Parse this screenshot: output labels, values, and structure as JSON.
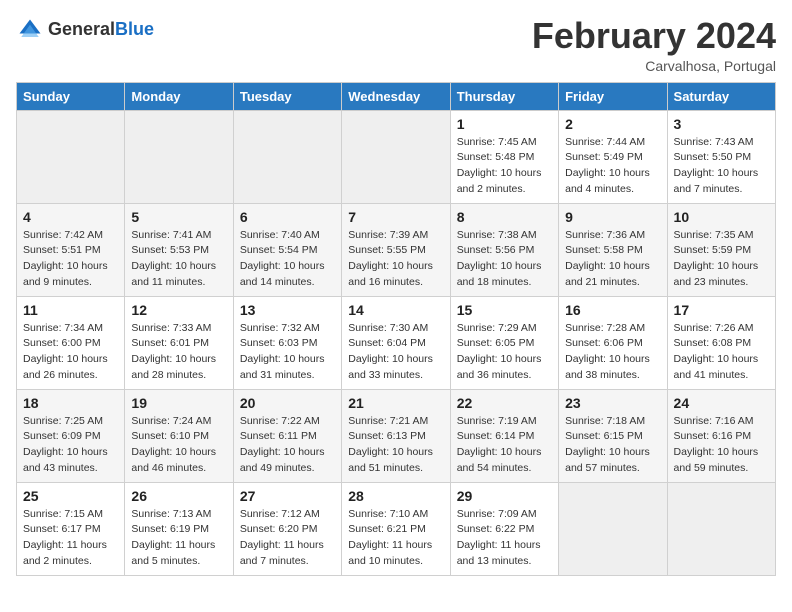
{
  "header": {
    "logo_general": "General",
    "logo_blue": "Blue",
    "month_year": "February 2024",
    "location": "Carvalhosa, Portugal"
  },
  "weekdays": [
    "Sunday",
    "Monday",
    "Tuesday",
    "Wednesday",
    "Thursday",
    "Friday",
    "Saturday"
  ],
  "weeks": [
    [
      {
        "day": "",
        "empty": true
      },
      {
        "day": "",
        "empty": true
      },
      {
        "day": "",
        "empty": true
      },
      {
        "day": "",
        "empty": true
      },
      {
        "day": "1",
        "sunrise": "7:45 AM",
        "sunset": "5:48 PM",
        "daylight": "10 hours and 2 minutes."
      },
      {
        "day": "2",
        "sunrise": "7:44 AM",
        "sunset": "5:49 PM",
        "daylight": "10 hours and 4 minutes."
      },
      {
        "day": "3",
        "sunrise": "7:43 AM",
        "sunset": "5:50 PM",
        "daylight": "10 hours and 7 minutes."
      }
    ],
    [
      {
        "day": "4",
        "sunrise": "7:42 AM",
        "sunset": "5:51 PM",
        "daylight": "10 hours and 9 minutes."
      },
      {
        "day": "5",
        "sunrise": "7:41 AM",
        "sunset": "5:53 PM",
        "daylight": "10 hours and 11 minutes."
      },
      {
        "day": "6",
        "sunrise": "7:40 AM",
        "sunset": "5:54 PM",
        "daylight": "10 hours and 14 minutes."
      },
      {
        "day": "7",
        "sunrise": "7:39 AM",
        "sunset": "5:55 PM",
        "daylight": "10 hours and 16 minutes."
      },
      {
        "day": "8",
        "sunrise": "7:38 AM",
        "sunset": "5:56 PM",
        "daylight": "10 hours and 18 minutes."
      },
      {
        "day": "9",
        "sunrise": "7:36 AM",
        "sunset": "5:58 PM",
        "daylight": "10 hours and 21 minutes."
      },
      {
        "day": "10",
        "sunrise": "7:35 AM",
        "sunset": "5:59 PM",
        "daylight": "10 hours and 23 minutes."
      }
    ],
    [
      {
        "day": "11",
        "sunrise": "7:34 AM",
        "sunset": "6:00 PM",
        "daylight": "10 hours and 26 minutes."
      },
      {
        "day": "12",
        "sunrise": "7:33 AM",
        "sunset": "6:01 PM",
        "daylight": "10 hours and 28 minutes."
      },
      {
        "day": "13",
        "sunrise": "7:32 AM",
        "sunset": "6:03 PM",
        "daylight": "10 hours and 31 minutes."
      },
      {
        "day": "14",
        "sunrise": "7:30 AM",
        "sunset": "6:04 PM",
        "daylight": "10 hours and 33 minutes."
      },
      {
        "day": "15",
        "sunrise": "7:29 AM",
        "sunset": "6:05 PM",
        "daylight": "10 hours and 36 minutes."
      },
      {
        "day": "16",
        "sunrise": "7:28 AM",
        "sunset": "6:06 PM",
        "daylight": "10 hours and 38 minutes."
      },
      {
        "day": "17",
        "sunrise": "7:26 AM",
        "sunset": "6:08 PM",
        "daylight": "10 hours and 41 minutes."
      }
    ],
    [
      {
        "day": "18",
        "sunrise": "7:25 AM",
        "sunset": "6:09 PM",
        "daylight": "10 hours and 43 minutes."
      },
      {
        "day": "19",
        "sunrise": "7:24 AM",
        "sunset": "6:10 PM",
        "daylight": "10 hours and 46 minutes."
      },
      {
        "day": "20",
        "sunrise": "7:22 AM",
        "sunset": "6:11 PM",
        "daylight": "10 hours and 49 minutes."
      },
      {
        "day": "21",
        "sunrise": "7:21 AM",
        "sunset": "6:13 PM",
        "daylight": "10 hours and 51 minutes."
      },
      {
        "day": "22",
        "sunrise": "7:19 AM",
        "sunset": "6:14 PM",
        "daylight": "10 hours and 54 minutes."
      },
      {
        "day": "23",
        "sunrise": "7:18 AM",
        "sunset": "6:15 PM",
        "daylight": "10 hours and 57 minutes."
      },
      {
        "day": "24",
        "sunrise": "7:16 AM",
        "sunset": "6:16 PM",
        "daylight": "10 hours and 59 minutes."
      }
    ],
    [
      {
        "day": "25",
        "sunrise": "7:15 AM",
        "sunset": "6:17 PM",
        "daylight": "11 hours and 2 minutes."
      },
      {
        "day": "26",
        "sunrise": "7:13 AM",
        "sunset": "6:19 PM",
        "daylight": "11 hours and 5 minutes."
      },
      {
        "day": "27",
        "sunrise": "7:12 AM",
        "sunset": "6:20 PM",
        "daylight": "11 hours and 7 minutes."
      },
      {
        "day": "28",
        "sunrise": "7:10 AM",
        "sunset": "6:21 PM",
        "daylight": "11 hours and 10 minutes."
      },
      {
        "day": "29",
        "sunrise": "7:09 AM",
        "sunset": "6:22 PM",
        "daylight": "11 hours and 13 minutes."
      },
      {
        "day": "",
        "empty": true
      },
      {
        "day": "",
        "empty": true
      }
    ]
  ]
}
